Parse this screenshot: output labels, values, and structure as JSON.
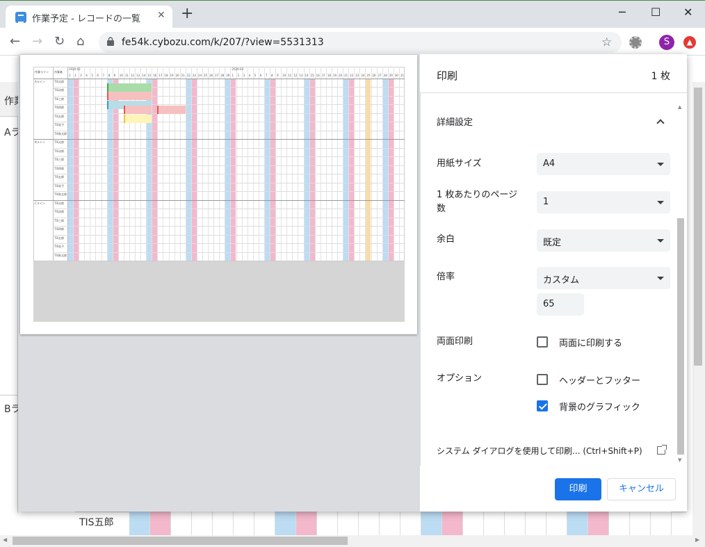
{
  "browser": {
    "tab_title": "作業予定 - レコードの一覧",
    "new_tab": "+",
    "url": "fe54k.cybozu.com/k/207/?view=5531313",
    "avatar_initial": "S",
    "window_minimize": "─",
    "window_maximize": "☐",
    "window_close": "✕"
  },
  "background_page": {
    "header_cell": "作業",
    "row_a_label": "Aラ",
    "row_b_label": "Bラ",
    "bottom_row_label": "TIS五郎"
  },
  "print_dialog": {
    "title": "印刷",
    "sheet_count": "1 枚",
    "section_title": "詳細設定",
    "paper_size": {
      "label": "用紙サイズ",
      "value": "A4"
    },
    "pages_per_sheet": {
      "label": "1 枚あたりのページ数",
      "value": "1"
    },
    "margins": {
      "label": "余白",
      "value": "既定"
    },
    "scale": {
      "label": "倍率",
      "value": "カスタム",
      "custom_value": "65"
    },
    "duplex": {
      "label": "両面印刷",
      "checkbox_label": "両面に印刷する",
      "checked": false
    },
    "options": {
      "label": "オプション",
      "headers_footers": {
        "label": "ヘッダーとフッター",
        "checked": false
      },
      "background_graphics": {
        "label": "背景のグラフィック",
        "checked": true
      }
    },
    "system_dialog_link": "システム ダイアログを使用して印刷... (Ctrl+Shift+P)",
    "print_button": "印刷",
    "cancel_button": "キャンセル"
  },
  "preview": {
    "col_line": "作業ライン",
    "col_worker": "作業者",
    "month1": "2020-02",
    "month2": "2020-03",
    "days_feb": [
      "1",
      "2",
      "3",
      "4",
      "5",
      "6",
      "7",
      "8",
      "9",
      "10",
      "11",
      "12",
      "13",
      "14",
      "15",
      "16",
      "17",
      "18",
      "19",
      "20",
      "21",
      "22",
      "23",
      "24",
      "25",
      "26",
      "27",
      "28",
      "29"
    ],
    "days_mar": [
      "1",
      "2",
      "3",
      "4",
      "5",
      "6",
      "7",
      "8",
      "9",
      "10",
      "11",
      "12",
      "13",
      "14",
      "15",
      "16",
      "17",
      "18",
      "19",
      "20",
      "21",
      "22",
      "23",
      "24",
      "25",
      "26",
      "27",
      "28",
      "29",
      "30",
      "31"
    ],
    "lines": [
      "Aライン",
      "Bライン",
      "Cライン"
    ],
    "workers": [
      "TIS太郎",
      "TIS次郎",
      "TIS三郎",
      "TIS四郎",
      "TIS五郎",
      "TIS花子",
      "TIS秋太郎",
      "TIS太郎",
      "TIS次郎",
      "TIS三郎",
      "TIS四郎",
      "TIS五郎",
      "TIS花子",
      "TIS秋太郎",
      "TIS太郎",
      "TIS次郎",
      "TIS三郎",
      "TIS四郎",
      "TIS五郎",
      "TIS花子",
      "TIS秋太郎"
    ]
  },
  "colors": {
    "accent": "#1a73e8",
    "saturday": "#bcdcf4",
    "sunday": "#f4b8cc",
    "holiday": "#f9dca8"
  }
}
